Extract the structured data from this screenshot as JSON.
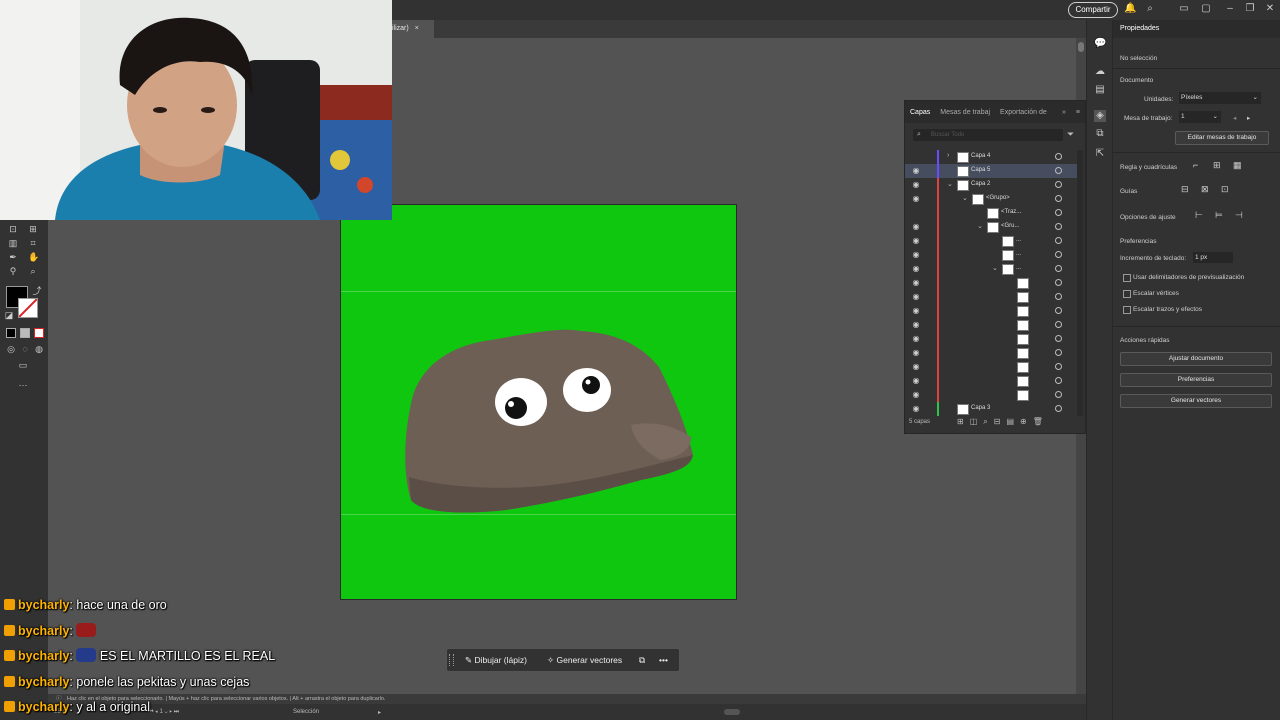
{
  "doc_tab": {
    "label": "ilizar)",
    "close": "×"
  },
  "topbar": {
    "share_label": "Compartir"
  },
  "layers_panel": {
    "tabs": [
      "Capas",
      "Mesas de trabaj",
      "Exportación de"
    ],
    "search_placeholder": "Buscar Todo",
    "rows": [
      {
        "name": "Capa 4",
        "eye": false,
        "indent": 0,
        "chevron": "›",
        "color": "#6a4cff",
        "selected": false
      },
      {
        "name": "Capa 5",
        "eye": true,
        "indent": 0,
        "chevron": "",
        "color": "#6a4cff",
        "selected": true
      },
      {
        "name": "Capa 2",
        "eye": true,
        "indent": 0,
        "chevron": "⌄",
        "color": "#e0423f",
        "selected": false
      },
      {
        "name": "<Grupo>",
        "eye": true,
        "indent": 1,
        "chevron": "⌄",
        "color": "#e0423f",
        "selected": false
      },
      {
        "name": "<Traz...",
        "eye": false,
        "indent": 2,
        "chevron": "",
        "color": "#e0423f",
        "selected": false
      },
      {
        "name": "<Gru...",
        "eye": true,
        "indent": 2,
        "chevron": "⌄",
        "color": "#e0423f",
        "selected": false
      },
      {
        "name": "...",
        "eye": true,
        "indent": 3,
        "chevron": "",
        "color": "#e0423f",
        "selected": false
      },
      {
        "name": "...",
        "eye": true,
        "indent": 3,
        "chevron": "",
        "color": "#e0423f",
        "selected": false
      },
      {
        "name": "...",
        "eye": true,
        "indent": 3,
        "chevron": "⌄",
        "color": "#e0423f",
        "selected": false
      },
      {
        "name": "",
        "eye": true,
        "indent": 4,
        "chevron": "",
        "color": "#e0423f",
        "selected": false
      },
      {
        "name": "",
        "eye": true,
        "indent": 4,
        "chevron": "",
        "color": "#e0423f",
        "selected": false
      },
      {
        "name": "",
        "eye": true,
        "indent": 4,
        "chevron": "",
        "color": "#e0423f",
        "selected": false
      },
      {
        "name": "",
        "eye": true,
        "indent": 4,
        "chevron": "",
        "color": "#e0423f",
        "selected": false
      },
      {
        "name": "",
        "eye": true,
        "indent": 4,
        "chevron": "",
        "color": "#e0423f",
        "selected": false
      },
      {
        "name": "",
        "eye": true,
        "indent": 4,
        "chevron": "",
        "color": "#e0423f",
        "selected": false
      },
      {
        "name": "",
        "eye": true,
        "indent": 4,
        "chevron": "",
        "color": "#e0423f",
        "selected": false
      },
      {
        "name": "",
        "eye": true,
        "indent": 4,
        "chevron": "",
        "color": "#e0423f",
        "selected": false
      },
      {
        "name": "",
        "eye": true,
        "indent": 4,
        "chevron": "",
        "color": "#e0423f",
        "selected": false
      },
      {
        "name": "Capa 3",
        "eye": true,
        "indent": 0,
        "chevron": "",
        "color": "#2ec44a",
        "selected": false
      }
    ],
    "footer_count": "5 capas"
  },
  "properties": {
    "title": "Propiedades",
    "no_selection": "No selección",
    "document_label": "Documento",
    "units_label": "Unidades:",
    "units_value": "Píxeles",
    "artboard_label": "Mesa de trabajo:",
    "artboard_value": "1",
    "edit_artboards": "Editar mesas de trabajo",
    "rulers_label": "Regla y cuadrículas",
    "guides_label": "Guías",
    "snap_label": "Opciones de ajuste",
    "prefs_label": "Preferencias",
    "keyboard_inc_label": "Incremento de teclado:",
    "keyboard_inc_value": "1 px",
    "check_preview_bounds": "Usar delimitadores de previsualización",
    "check_scale_corners": "Escalar vértices",
    "check_scale_strokes": "Escalar trazos y efectos",
    "quick_actions_label": "Acciones rápidas",
    "btn_fit_doc": "Ajustar documento",
    "btn_prefs": "Preferencias",
    "btn_vectors": "Generar vectores"
  },
  "context_bar": {
    "draw_label": "Dibujar (lápiz)",
    "vectors_label": "Generar vectores",
    "more": "•••"
  },
  "status": {
    "hint": "Haz clic en el objeto para seleccionarlo. | Mayús + haz clic para seleccionar varios objetos. | Alt + arrastra el objeto para duplicarlo.",
    "zoom": "25%",
    "artboard_num": "1",
    "tool": "Selección"
  },
  "chat": [
    {
      "user": "bycharly",
      "text": "hace una de oro",
      "emote": ""
    },
    {
      "user": "bycharly",
      "text": "",
      "emote": "red"
    },
    {
      "user": "bycharly",
      "text": "ES EL MARTILLO ES EL REAL",
      "emote": "blue"
    },
    {
      "user": "bycharly",
      "text": "ponele las pekitas y unas cejas",
      "emote": ""
    },
    {
      "user": "bycharly",
      "text": "y al a original",
      "emote": ""
    }
  ],
  "colors": {
    "artboard": "#0fc70f",
    "rock": "#6e5f55",
    "accent": "#4a5a7a"
  }
}
